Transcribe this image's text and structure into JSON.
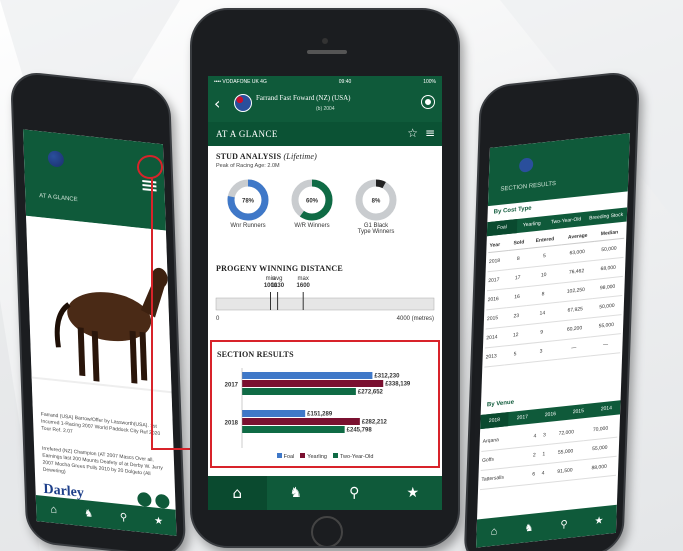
{
  "colors": {
    "brand_green": "#0f5a3a",
    "highlight_red": "#d8232a",
    "bar_blue": "#3f78c8",
    "bar_maroon": "#7a1030",
    "bar_green": "#0f6b45"
  },
  "center": {
    "status": {
      "carrier": "•••• VODAFONE UK 4G",
      "time": "09:40",
      "battery": "100%"
    },
    "horse_name": "Farrand Fast Foward (NZ) (USA)",
    "horse_sub": "(b) 2004",
    "section_header": "AT A GLANCE",
    "stud_analysis": {
      "title": "STUD ANALYSIS",
      "title_suffix": "(Lifetime)",
      "subtitle": "Peak of Racing Age: 2.0M",
      "donuts": [
        {
          "pct": 0.78,
          "label": "78%",
          "caption": "Wnr Runners",
          "color": "#3f78c8"
        },
        {
          "pct": 0.6,
          "label": "60%",
          "caption": "W/R Winners",
          "color": "#0f6b45"
        },
        {
          "pct": 0.08,
          "label": "8%",
          "caption": "G1 Black Type Winners",
          "color": "#222222"
        }
      ]
    },
    "progeny": {
      "title": "PROGENY WINNING DISTANCE",
      "markers": [
        {
          "top": "min",
          "bottom": "1000"
        },
        {
          "top": "avg",
          "bottom": "1130"
        },
        {
          "top": "max",
          "bottom": "1600"
        }
      ],
      "axis_start": "0",
      "axis_end": "4000 (metres)"
    },
    "section_results": {
      "title": "SECTION RESULTS",
      "legend": [
        "Foal",
        "Yearling",
        "Two-Year-Old"
      ]
    },
    "tabs": [
      "home-icon",
      "horse-icon",
      "search-icon",
      "star-icon"
    ]
  },
  "chart_data": {
    "type": "bar",
    "orientation": "horizontal",
    "title": "SECTION RESULTS",
    "categories": [
      "2017",
      "2018"
    ],
    "series": [
      {
        "name": "Foal",
        "values": [
          312230,
          151289
        ],
        "labels": [
          "£312,230",
          "£151,289"
        ],
        "color": "#3f78c8"
      },
      {
        "name": "Yearling",
        "values": [
          338139,
          282212
        ],
        "labels": [
          "£338,139",
          "£282,212"
        ],
        "color": "#7a1030"
      },
      {
        "name": "Two-Year-Old",
        "values": [
          272652,
          245798
        ],
        "labels": [
          "£272,652",
          "£245,798"
        ],
        "color": "#0f6b45"
      }
    ],
    "xlim": [
      0,
      340000
    ],
    "legend_position": "bottom",
    "grid": false
  },
  "left": {
    "section_header": "AT A GLANCE",
    "text_block_1": "Farrand (USA) Barrow/Offer by Lassworth(USA). 1st Incurred 1-Racing 2007 World Paddock City Ref 2020 Tour Ref. 2.07",
    "text_block_2": "Irrefered (NZ) Champion (AT 2007 Mascs Over all. Earnings last 200 Mounts Deafety of at Derby W. Jerry 2007 Mocha Grees Pulls 2010 by 20 Dolgeto (All Dewering)",
    "brand": "Darley",
    "tabs": [
      "home-icon",
      "horse-icon",
      "search-icon",
      "star-icon"
    ]
  },
  "right": {
    "section_header": "SECTION RESULTS",
    "subhead": "By Cost Type",
    "tabs_top": [
      "Foal",
      "Yearling",
      "Two-Year-Old",
      "Breeding Stock"
    ],
    "columns": [
      "Year",
      "Sold",
      "Entered",
      "Average",
      "Median"
    ],
    "rows": [
      [
        "2018",
        "8",
        "5",
        "63,000",
        "50,000"
      ],
      [
        "2017",
        "17",
        "10",
        "76,462",
        "68,000"
      ],
      [
        "2016",
        "16",
        "8",
        "102,250",
        "98,000"
      ],
      [
        "2015",
        "23",
        "14",
        "67,925",
        "50,000"
      ],
      [
        "2014",
        "12",
        "9",
        "60,200",
        "55,000"
      ],
      [
        "2013",
        "5",
        "3",
        "—",
        "—"
      ]
    ],
    "subhead2": "By Venue",
    "tabs_bottom": [
      "2018",
      "2017",
      "2016",
      "2015",
      "2014"
    ],
    "rows2": [
      [
        "Arqana",
        "4",
        "3",
        "72,000",
        "70,000"
      ],
      [
        "Goffs",
        "2",
        "1",
        "55,000",
        "55,000"
      ],
      [
        "Tattersalls",
        "6",
        "4",
        "91,500",
        "88,000"
      ]
    ],
    "tabs": [
      "home-icon",
      "horse-icon",
      "search-icon",
      "star-icon"
    ]
  }
}
